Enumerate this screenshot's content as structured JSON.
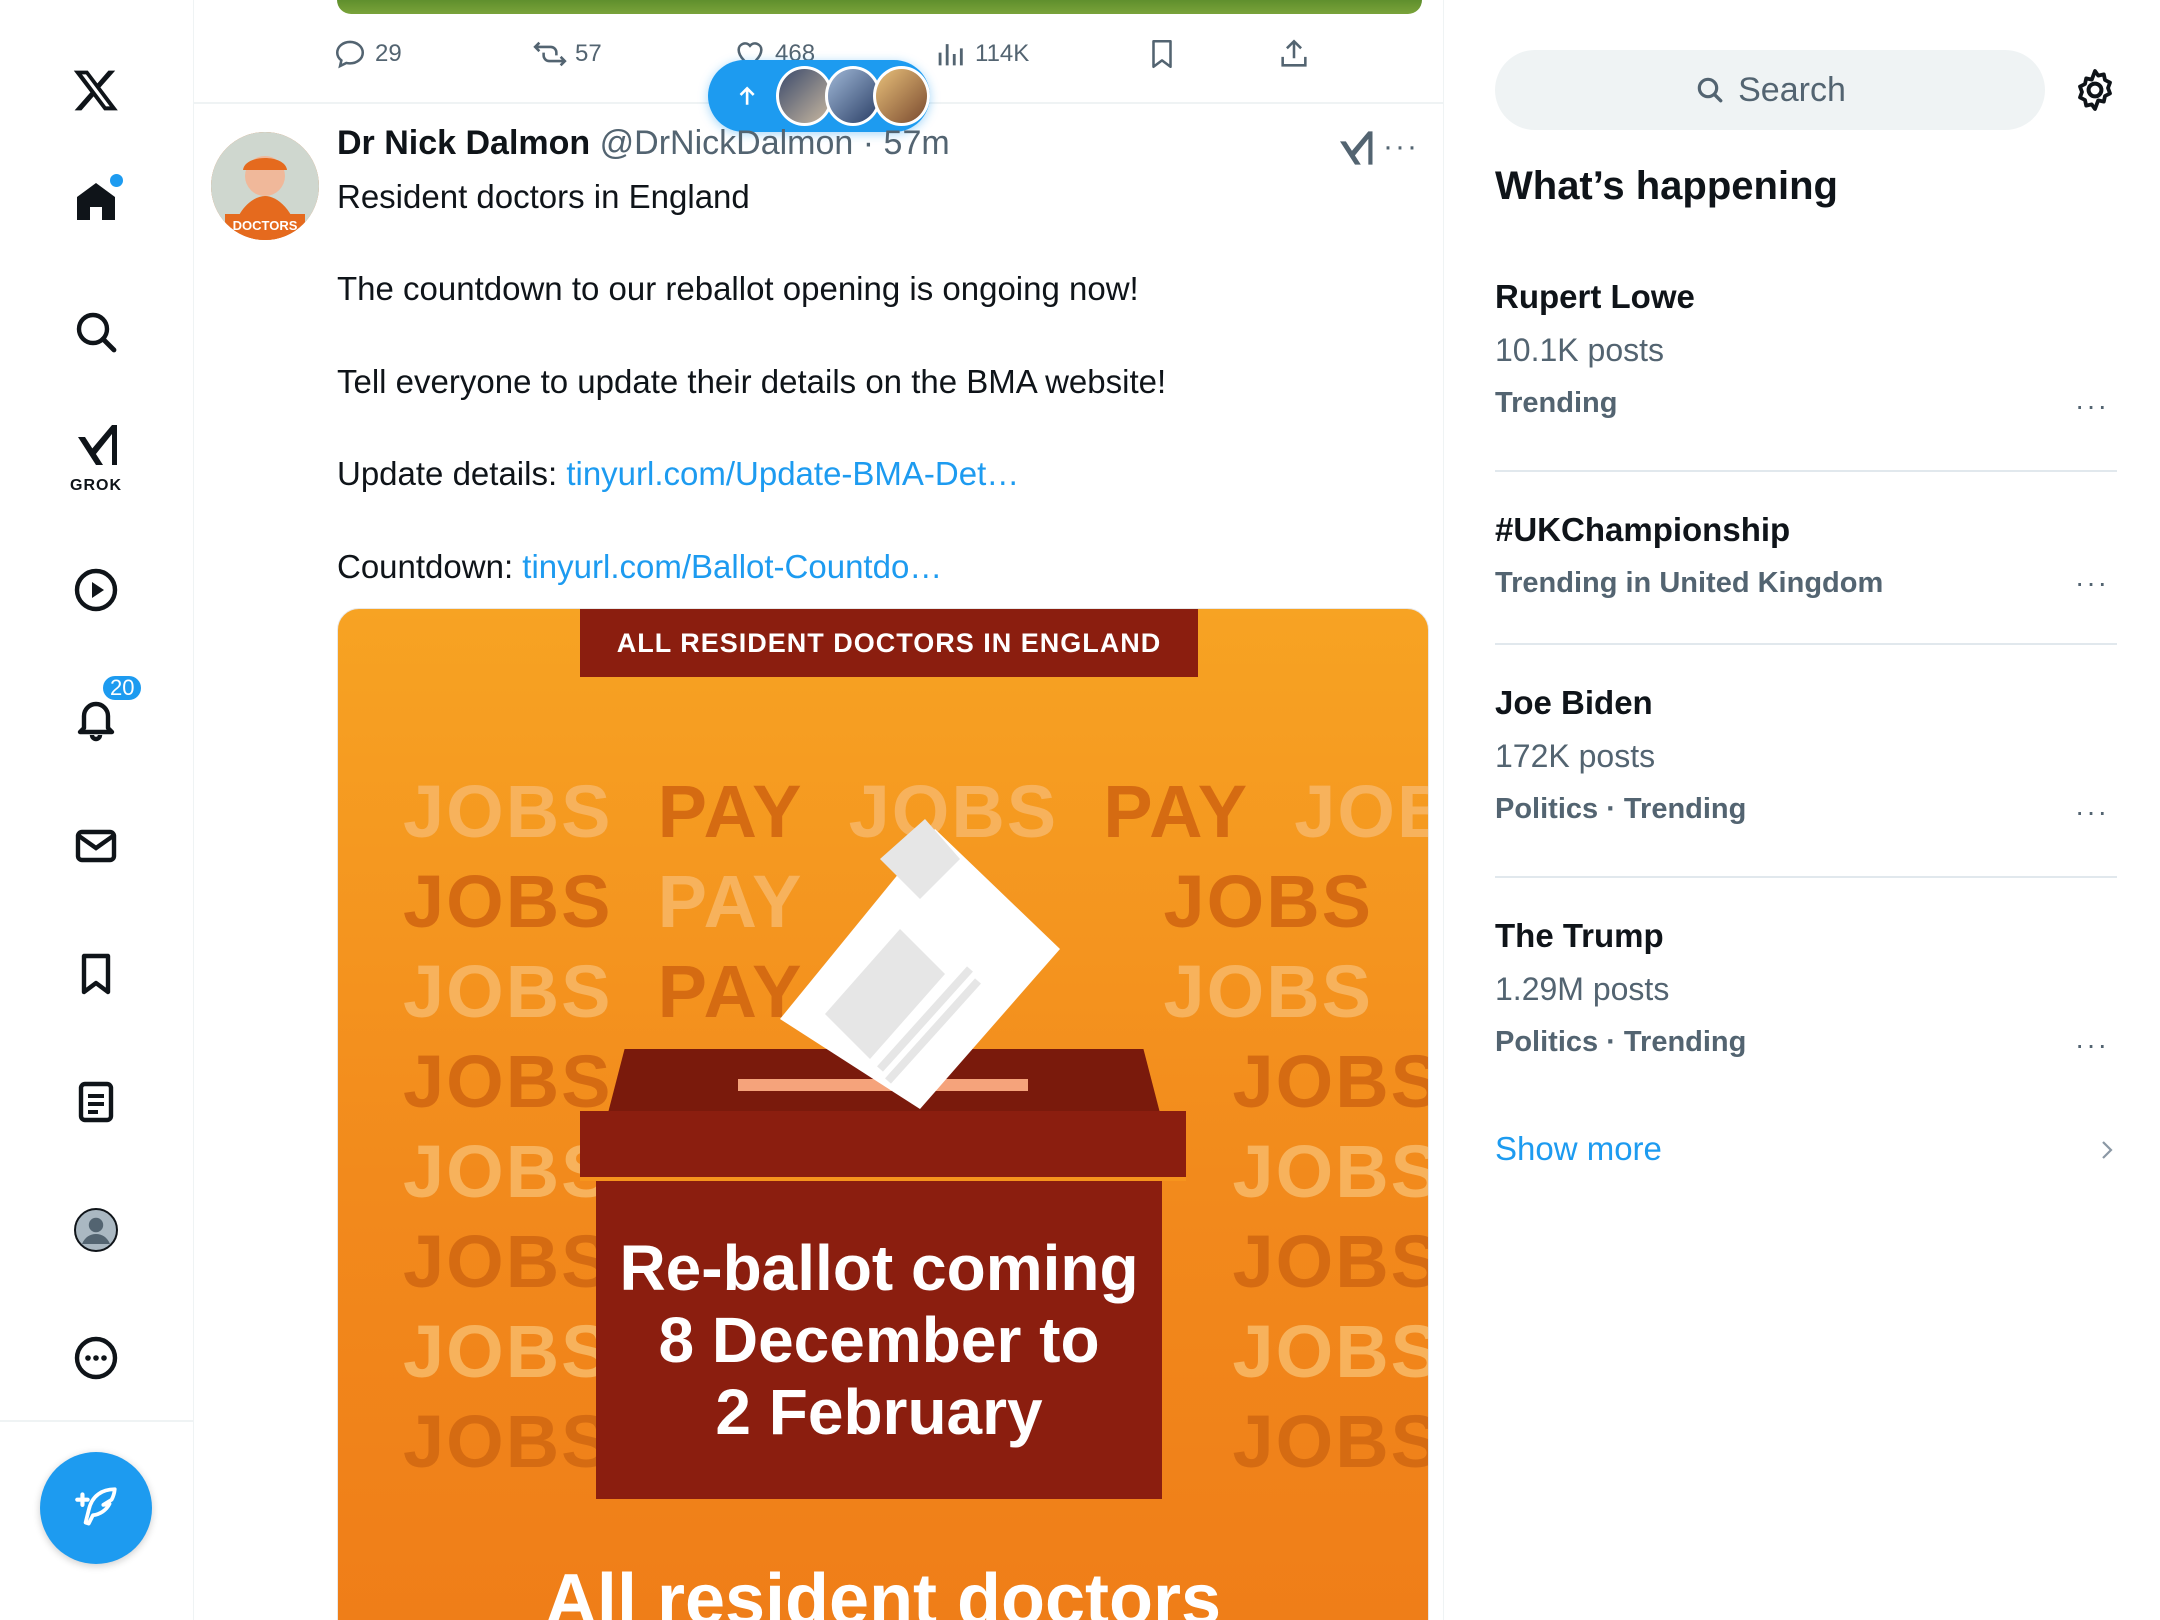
{
  "nav": {
    "logo": "X",
    "items": [
      {
        "name": "home",
        "icon": "home-icon"
      },
      {
        "name": "explore",
        "icon": "search-icon"
      },
      {
        "name": "grok",
        "icon": "grok-icon",
        "label": "GROK"
      },
      {
        "name": "videos",
        "icon": "play-icon"
      },
      {
        "name": "notifications",
        "icon": "bell-icon",
        "badge": "20"
      },
      {
        "name": "messages",
        "icon": "mail-icon"
      },
      {
        "name": "bookmarks",
        "icon": "bookmark-icon"
      },
      {
        "name": "lists",
        "icon": "list-icon"
      },
      {
        "name": "profile",
        "icon": "avatar-icon"
      },
      {
        "name": "more",
        "icon": "more-circle-icon"
      }
    ],
    "compose_icon": "compose-icon"
  },
  "previous_post": {
    "replies": "29",
    "reposts": "57",
    "likes": "468",
    "views": "114K"
  },
  "new_posts_pill": {
    "icon": "arrow-up-icon"
  },
  "post": {
    "author_name": "Dr Nick Dalmon",
    "handle": "@DrNickDalmon",
    "separator": "·",
    "time": "57m",
    "avatar_label": "DOCTORS",
    "lines": {
      "line1": "Resident doctors in England",
      "line2": "The countdown to our reballot opening is ongoing now!",
      "line3": "Tell everyone to update their details on the BMA website!",
      "line4_prefix": "Update details: ",
      "line4_link": "tinyurl.com/Update-BMA-Det…",
      "line5_prefix": "Countdown: ",
      "line5_link": "tinyurl.com/Ballot-Countdo…"
    },
    "image": {
      "banner": "ALL RESIDENT DOCTORS IN ENGLAND",
      "watermark_jobs": "JOBS",
      "watermark_pay": "PAY",
      "box_line1": "Re-ballot coming",
      "box_line2": "8 December to",
      "box_line3": "2 February",
      "bottom_text": "All resident doctors"
    }
  },
  "right": {
    "search_placeholder": "Search",
    "section_title": "What’s happening",
    "trends": [
      {
        "name": "Rupert Lowe",
        "posts": "10.1K posts",
        "meta": "Trending"
      },
      {
        "name": "#UKChampionship",
        "posts": "",
        "meta": "Trending in United Kingdom"
      },
      {
        "name": "Joe Biden",
        "posts": "172K posts",
        "meta": "Politics · Trending"
      },
      {
        "name": "The Trump",
        "posts": "1.29M posts",
        "meta": "Politics · Trending"
      }
    ],
    "show_more": "Show more"
  },
  "colors": {
    "accent": "#1d9bf0",
    "text": "#0f1419",
    "muted": "#536471",
    "ballot_red": "#8b1e0f",
    "image_orange": "#f28a1c"
  }
}
